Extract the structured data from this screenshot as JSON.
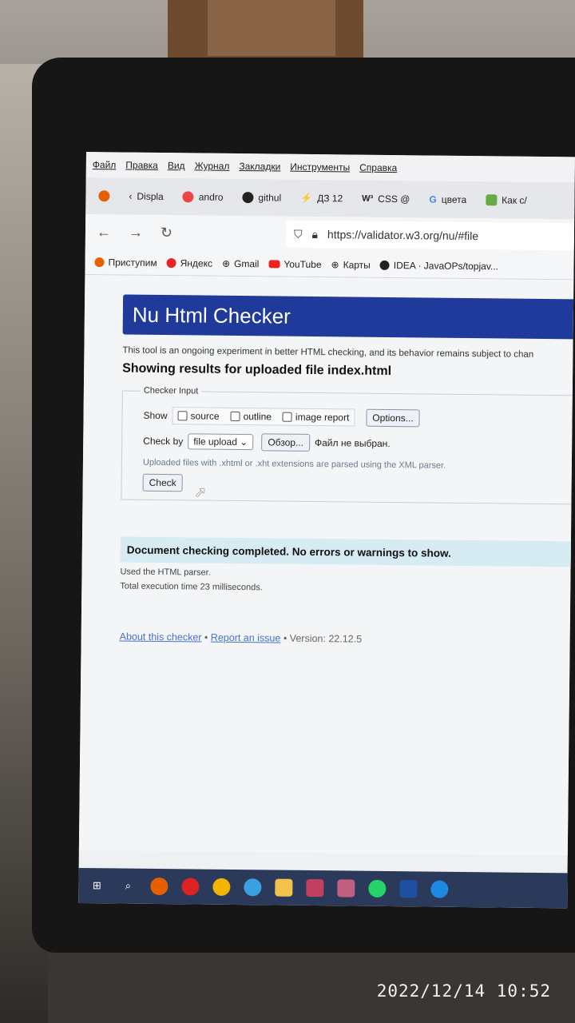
{
  "menu": [
    "Файл",
    "Правка",
    "Вид",
    "Журнал",
    "Закладки",
    "Инструменты",
    "Справка"
  ],
  "tabs": [
    {
      "icon": "firefox-icon",
      "label": ""
    },
    {
      "icon": "back-icon",
      "label": "Displa"
    },
    {
      "icon": "java-icon",
      "label": "andro"
    },
    {
      "icon": "github-icon",
      "label": "githul"
    },
    {
      "icon": "bolt-icon",
      "label": "ДЗ 12"
    },
    {
      "icon": "w3-icon",
      "label": "CSS @"
    },
    {
      "icon": "google-icon",
      "label": "цвета"
    },
    {
      "icon": "e-icon",
      "label": "Как с/"
    }
  ],
  "nav": {
    "back": "←",
    "forward": "→",
    "reload": "↻",
    "url": "https://validator.w3.org/nu/#file"
  },
  "bookmarks": [
    {
      "icon": "firefox-icon",
      "label": "Приступим"
    },
    {
      "icon": "yandex-icon",
      "label": "Яндекс"
    },
    {
      "icon": "globe-icon",
      "label": "Gmail"
    },
    {
      "icon": "youtube-icon",
      "label": "YouTube"
    },
    {
      "icon": "globe-icon",
      "label": "Карты"
    },
    {
      "icon": "github-icon",
      "label": "IDEA · JavaOPs/topjav..."
    }
  ],
  "page": {
    "banner": "Nu Html Checker",
    "intro": "This tool is an ongoing experiment in better HTML checking, and its behavior remains subject to chan",
    "heading": "Showing results for uploaded file index.html",
    "legend": "Checker Input",
    "show_label": "Show",
    "check_source": "source",
    "check_outline": "outline",
    "check_image": "image report",
    "options_btn": "Options...",
    "checkby_label": "Check by",
    "select_value": "file upload",
    "browse_btn": "Обзор...",
    "no_file": "Файл не выбран.",
    "note": "Uploaded files with .xhtml or .xht extensions are parsed using the XML parser.",
    "check_btn": "Check",
    "success": "Document checking completed. No errors or warnings to show.",
    "parser": "Used the HTML parser.",
    "exec_time": "Total execution time 23 milliseconds.",
    "about": "About this checker",
    "report": "Report an issue",
    "version": "• Version: 22.12.5"
  },
  "timestamp": "2022/12/14  10:52",
  "colors": {
    "banner": "#1f3a9a",
    "success_bg": "#d6ebf2",
    "link": "#4a6fd0"
  }
}
